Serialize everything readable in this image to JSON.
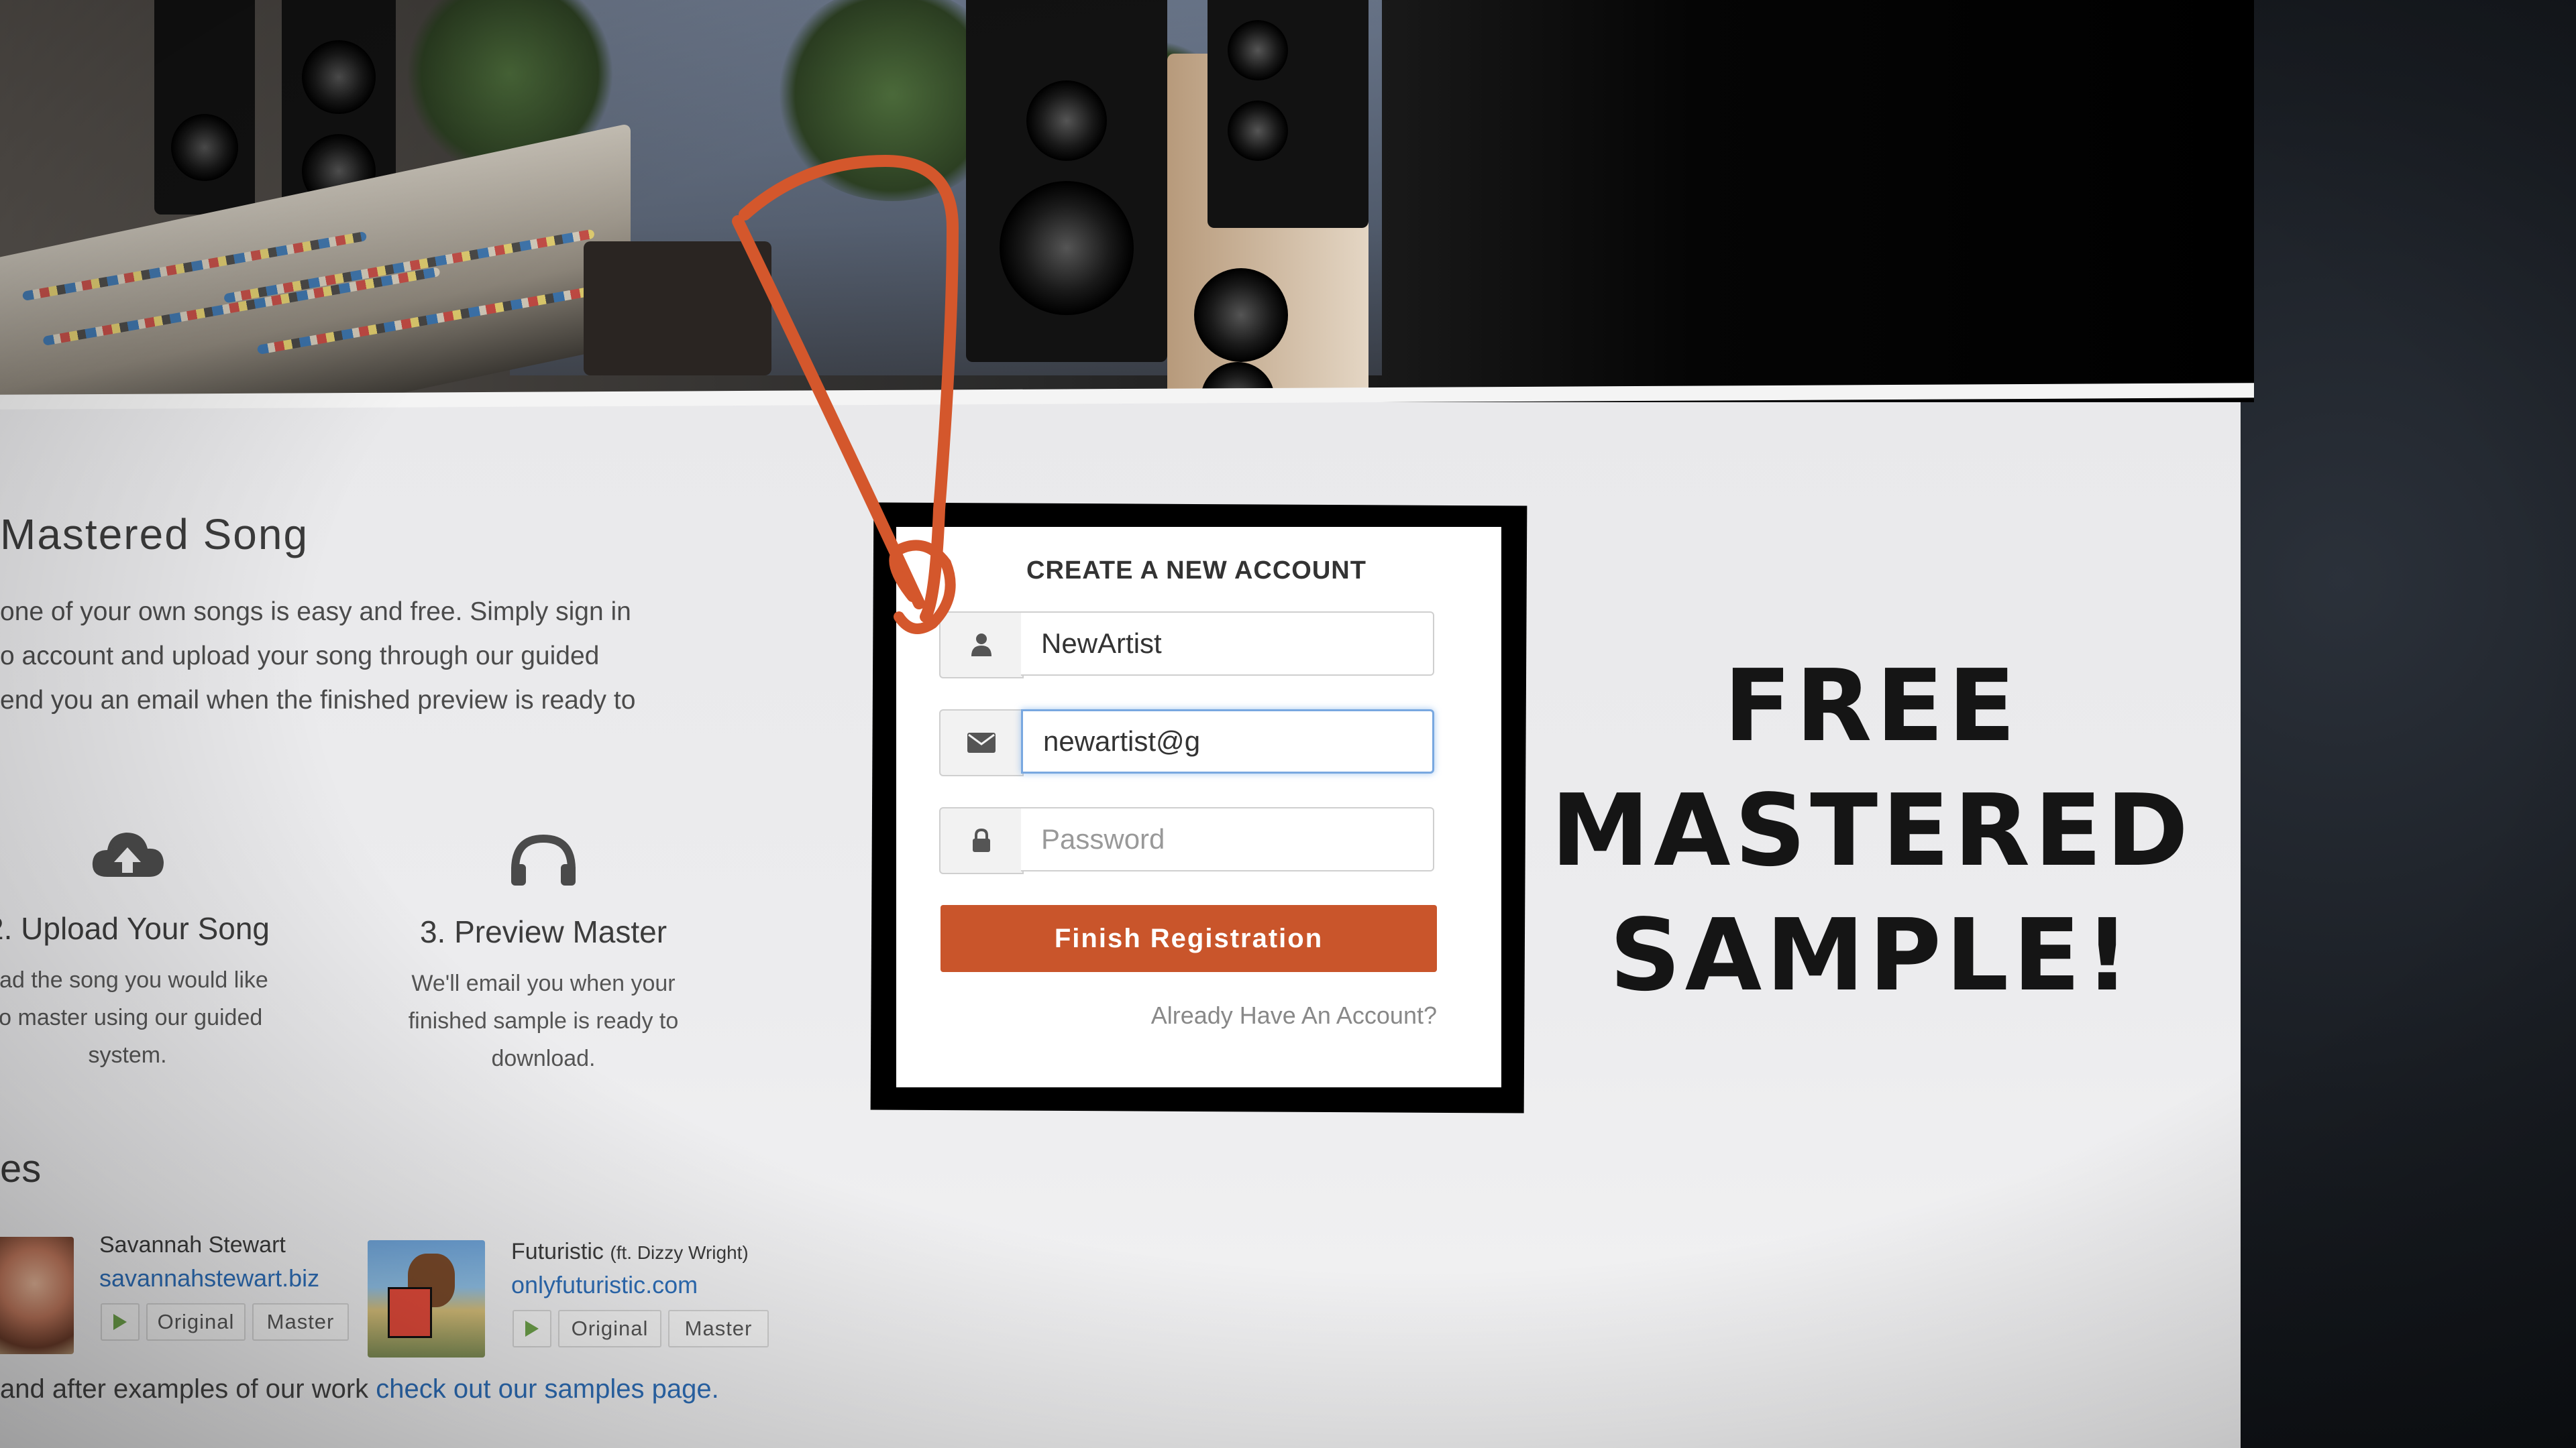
{
  "hero": {
    "image": "studio-photo"
  },
  "intro": {
    "title": "Mastered Song",
    "lines": [
      "one of your own songs is easy and free. Simply sign in",
      "o account and upload your song through our guided",
      "end you an email when the finished preview is ready to"
    ]
  },
  "steps": [
    {
      "icon": "cloud-upload-icon",
      "title": "2. Upload Your Song",
      "desc": [
        "oad the song you would like",
        "to master using our guided",
        "system."
      ]
    },
    {
      "icon": "headphones-icon",
      "title": "3. Preview Master",
      "desc": [
        "We'll email you when your",
        "finished sample is ready to",
        "download."
      ]
    }
  ],
  "samples": {
    "title": "es",
    "items": [
      {
        "artist": "Savannah Stewart",
        "feat": "",
        "link": "savannahstewart.biz",
        "original": "Original",
        "master": "Master"
      },
      {
        "artist": "Futuristic",
        "feat": "(ft. Dizzy Wright)",
        "link": "onlyfuturistic.com",
        "original": "Original",
        "master": "Master"
      }
    ],
    "footnote_prefix": "and after examples of our work ",
    "footnote_link": "check out our samples page."
  },
  "form": {
    "title": "CREATE A NEW ACCOUNT",
    "username": {
      "value": "NewArtist",
      "icon": "user-icon"
    },
    "email": {
      "value": "newartist@g",
      "icon": "envelope-icon"
    },
    "password": {
      "placeholder": "Password",
      "icon": "lock-icon"
    },
    "submit": "Finish Registration",
    "login_link": "Already Have An Account?"
  },
  "promo": {
    "lines": [
      "FREE",
      "MASTERED",
      "SAMPLE!"
    ]
  },
  "colors": {
    "accent": "#c9552b",
    "arrow": "#d4572c",
    "link": "#2d6eb8"
  }
}
